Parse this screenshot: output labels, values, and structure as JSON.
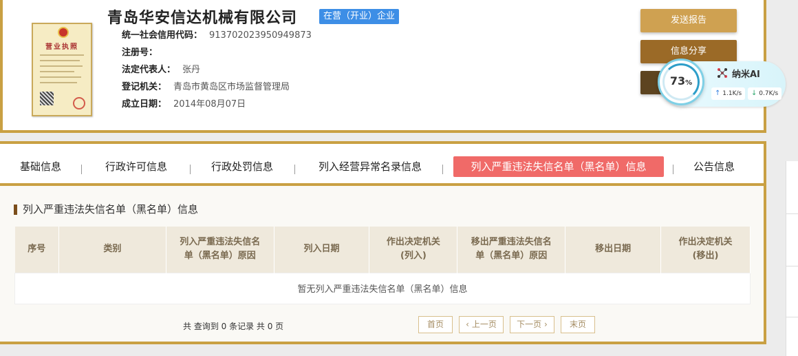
{
  "company": {
    "name": "青岛华安信达机械有限公司",
    "status": "在营（开业）企业",
    "license_title": "营业执照"
  },
  "info": [
    {
      "label": "统一社会信用代码：",
      "value": "913702023950949873"
    },
    {
      "label": "注册号：",
      "value": ""
    },
    {
      "label": "法定代表人：",
      "value": "张丹"
    },
    {
      "label": "登记机关：",
      "value": "青岛市黄岛区市场监督管理局"
    },
    {
      "label": "成立日期：",
      "value": "2014年08月07日"
    }
  ],
  "actions": {
    "report": "发送报告",
    "share": "信息分享"
  },
  "widget": {
    "percent": "73",
    "percent_unit": "%",
    "brand": "纳米AI",
    "up_arrow": "↑",
    "up_speed": "1.1K/s",
    "down_arrow": "↓",
    "down_speed": "0.7K/s"
  },
  "tabs": [
    {
      "label": "基础信息"
    },
    {
      "label": "行政许可信息"
    },
    {
      "label": "行政处罚信息"
    },
    {
      "label": "列入经营异常名录信息"
    },
    {
      "label": "列入严重违法失信名单（黑名单）信息",
      "active": true
    },
    {
      "label": "公告信息"
    }
  ],
  "section": {
    "title": "列入严重违法失信名单（黑名单）信息"
  },
  "table": {
    "headers": [
      [
        "序号"
      ],
      [
        "类别"
      ],
      [
        "列入严重违法失信名",
        "单（黑名单）原因"
      ],
      [
        "列入日期"
      ],
      [
        "作出决定机关",
        "(列入)"
      ],
      [
        "移出严重违法失信名",
        "单（黑名单）原因"
      ],
      [
        "移出日期"
      ],
      [
        "作出决定机关",
        "(移出)"
      ]
    ],
    "empty_text": "暂无列入严重违法失信名单（黑名单）信息"
  },
  "pagination": {
    "summary": "共 查询到 0 条记录 共 0 页",
    "first": "首页",
    "prev": "上一页",
    "next": "下一页",
    "last": "末页",
    "prev_icon": "‹",
    "next_icon": "›"
  }
}
